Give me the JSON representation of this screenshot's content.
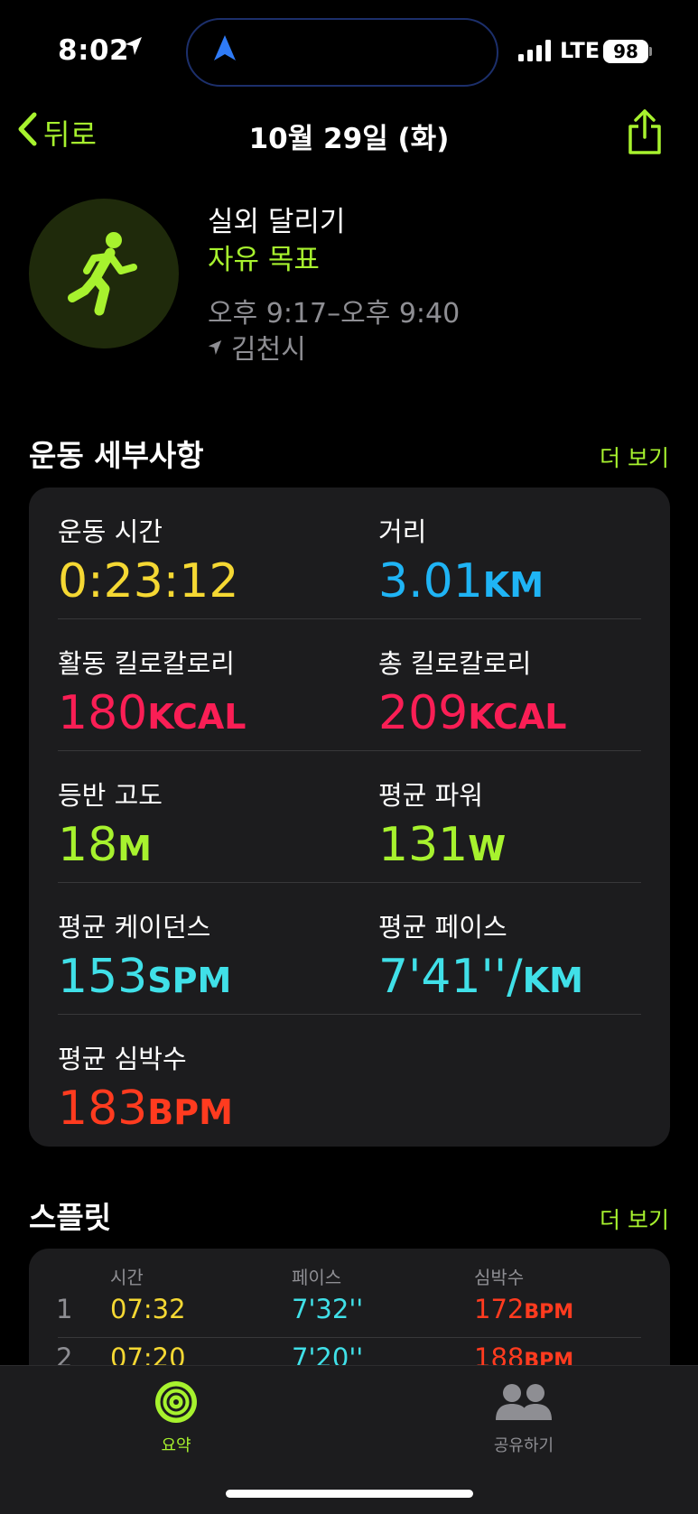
{
  "status_bar": {
    "time": "8:02",
    "network": "LTE",
    "battery": "98"
  },
  "header": {
    "back_label": "뒤로",
    "title": "10월 29일 (화)"
  },
  "workout": {
    "name": "실외 달리기",
    "goal": "자유 목표",
    "time_range": "오후 9:17–오후 9:40",
    "location": "김천시"
  },
  "details": {
    "section_title": "운동 세부사항",
    "more_label": "더 보기",
    "metrics": [
      {
        "label": "운동 시간",
        "value": "0:23:12",
        "unit": "",
        "color": "#f5d833"
      },
      {
        "label": "거리",
        "value": "3.01",
        "unit": "KM",
        "color": "#1fb4f5"
      },
      {
        "label": "활동 킬로칼로리",
        "value": "180",
        "unit": "KCAL",
        "color": "#fa1e55"
      },
      {
        "label": "총 킬로칼로리",
        "value": "209",
        "unit": "KCAL",
        "color": "#fa1e55"
      },
      {
        "label": "등반 고도",
        "value": "18",
        "unit": "M",
        "color": "#a7f22e"
      },
      {
        "label": "평균 파워",
        "value": "131",
        "unit": "W",
        "color": "#a7f22e"
      },
      {
        "label": "평균 케이던스",
        "value": "153",
        "unit": "SPM",
        "color": "#40e0e8"
      },
      {
        "label": "평균 페이스",
        "value": "7'41''/",
        "unit": "KM",
        "color": "#40e0e8"
      },
      {
        "label": "평균 심박수",
        "value": "183",
        "unit": "BPM",
        "color": "#ff3b1f"
      }
    ]
  },
  "splits": {
    "section_title": "스플릿",
    "more_label": "더 보기",
    "headers": {
      "time": "시간",
      "pace": "페이스",
      "hr": "심박수"
    },
    "rows": [
      {
        "num": "1",
        "time": "07:32",
        "pace": "7'32''",
        "hr": "172",
        "hr_unit": "BPM"
      },
      {
        "num": "2",
        "time": "07:20",
        "pace": "7'20''",
        "hr": "188",
        "hr_unit": "BPM"
      }
    ]
  },
  "tabs": {
    "summary_label": "요약",
    "sharing_label": "공유하기"
  }
}
